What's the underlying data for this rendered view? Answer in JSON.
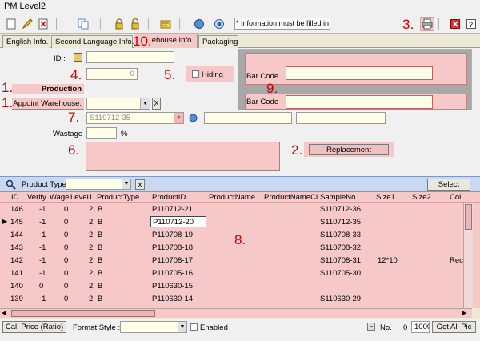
{
  "window": {
    "title": "PM Level2"
  },
  "toolbar": {
    "required_note": "* Information must be filled in",
    "icons": [
      "new-icon",
      "edit-icon",
      "delete-icon",
      "copy-icon",
      "lock-icon",
      "unlock-icon",
      "refresh-icon",
      "globe-icon",
      "help-icon",
      "print-icon",
      "close-icon",
      "question-icon"
    ]
  },
  "annotations": {
    "n1a": "1.",
    "n1b": "1.",
    "n2": "2.",
    "n3": "3.",
    "n4": "4.",
    "n5": "5.",
    "n6": "6.",
    "n7": "7.",
    "n8": "8.",
    "n9": "9.",
    "n10": "10."
  },
  "tabs": [
    {
      "label": "English Info."
    },
    {
      "label": "Second Language Info."
    },
    {
      "label": "ehouse Info."
    },
    {
      "label": "Packaging"
    }
  ],
  "form": {
    "id_label": "ID :",
    "id_value": "",
    "qty_value": "0",
    "hiding_label": "Hiding",
    "production_label": "Production",
    "appoint_label": "Appoint Warehouse:",
    "appoint_value": "",
    "clear_label": "X",
    "sample_value": "S110712-35",
    "wastage_label": "Wastage",
    "wastage_unit": "%",
    "replacement_label": "Replacement",
    "barcode_label_1": "Bar Code",
    "barcode_label_2": "Bar Code"
  },
  "filter": {
    "label": "Product Type",
    "value": "",
    "clear_label": "X",
    "select_label": "Select"
  },
  "grid": {
    "columns": [
      "ID",
      "Verify",
      "Wage",
      "Level1",
      "ProductType",
      "ProductID",
      "ProductName",
      "ProductNameCl",
      "SampleNo",
      "Size1",
      "Size2",
      "Col"
    ],
    "rows": [
      {
        "id": "146",
        "verify": "-1",
        "wage": "0",
        "level1": "2",
        "ptype": "B",
        "pid": "P110712-21",
        "pname": "",
        "pnamecl": "",
        "sample": "S110712-36",
        "size1": "",
        "size2": "",
        "col": ""
      },
      {
        "id": "145",
        "verify": "-1",
        "wage": "0",
        "level1": "2",
        "ptype": "B",
        "pid": "P110712-20",
        "pname": "",
        "pnamecl": "",
        "sample": "S110712-35",
        "size1": "",
        "size2": "",
        "col": ""
      },
      {
        "id": "144",
        "verify": "-1",
        "wage": "0",
        "level1": "2",
        "ptype": "B",
        "pid": "P110708-19",
        "pname": "",
        "pnamecl": "",
        "sample": "S110708-33",
        "size1": "",
        "size2": "",
        "col": ""
      },
      {
        "id": "143",
        "verify": "-1",
        "wage": "0",
        "level1": "2",
        "ptype": "B",
        "pid": "P110708-18",
        "pname": "",
        "pnamecl": "",
        "sample": "S110708-32",
        "size1": "",
        "size2": "",
        "col": ""
      },
      {
        "id": "142",
        "verify": "-1",
        "wage": "0",
        "level1": "2",
        "ptype": "B",
        "pid": "P110708-17",
        "pname": "",
        "pnamecl": "",
        "sample": "S110708-31",
        "size1": "12*10",
        "size2": "",
        "col": "Rec"
      },
      {
        "id": "141",
        "verify": "-1",
        "wage": "0",
        "level1": "2",
        "ptype": "B",
        "pid": "P110705-16",
        "pname": "",
        "pnamecl": "",
        "sample": "S110705-30",
        "size1": "",
        "size2": "",
        "col": ""
      },
      {
        "id": "140",
        "verify": "0",
        "wage": "0",
        "level1": "2",
        "ptype": "B",
        "pid": "P110630-15",
        "pname": "",
        "pnamecl": "",
        "sample": "",
        "size1": "",
        "size2": "",
        "col": ""
      },
      {
        "id": "139",
        "verify": "-1",
        "wage": "0",
        "level1": "2",
        "ptype": "B",
        "pid": "P110630-14",
        "pname": "",
        "pnamecl": "",
        "sample": "S110630-29",
        "size1": "",
        "size2": "",
        "col": ""
      }
    ]
  },
  "bottom": {
    "cal_price": "Cal. Price (Ratio)",
    "format_label": "Format Style :",
    "format_value": "",
    "enabled_label": "Enabled",
    "no_label": "No.",
    "no_value": "0",
    "count_value": "1000",
    "get_all": "Get All Pic"
  }
}
